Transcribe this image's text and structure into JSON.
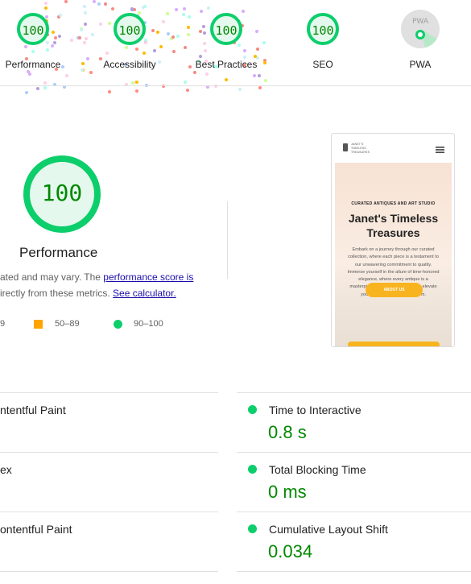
{
  "categories": [
    {
      "label": "Performance",
      "score": "100"
    },
    {
      "label": "Accessibility",
      "score": "100"
    },
    {
      "label": "Best Practices",
      "score": "100"
    },
    {
      "label": "SEO",
      "score": "100"
    }
  ],
  "pwa": {
    "label": "PWA",
    "badge_text": "PWA"
  },
  "colors": {
    "pass": "#0cce6b",
    "average": "#ffa400",
    "pass_text": "#008800"
  },
  "performance": {
    "score": "100",
    "title": "Performance",
    "line1_prefix": "ated and may vary. The ",
    "line1_link": "performance score is",
    "line2_prefix": "irectly from these metrics. ",
    "line2_link": "See calculator."
  },
  "legend": [
    {
      "range": "9"
    },
    {
      "range": "50–89"
    },
    {
      "range": "90–100"
    }
  ],
  "preview": {
    "logo_text": "JANET'S TIMELESS TREASURES",
    "eyebrow": "CURATED ANTIQUES AND ART STUDIO",
    "heading_line1": "Janet's Timeless",
    "heading_line2": "Treasures",
    "body": "Embark on a journey through our curated collection, where each piece is a testament to our unwavering commitment to quality. Immerse yourself in the allure of time-honored elegance, where every antique is a masterpiece meticulously chosen to elevate your space with enduring charm.",
    "button": "ABOUT US"
  },
  "metrics_left": [
    {
      "title": "ntentful Paint"
    },
    {
      "title": "ex"
    },
    {
      "title": "ontentful Paint"
    }
  ],
  "metrics_right": [
    {
      "title": "Time to Interactive",
      "value": "0.8 s"
    },
    {
      "title": "Total Blocking Time",
      "value": "0 ms"
    },
    {
      "title": "Cumulative Layout Shift",
      "value": "0.034"
    }
  ]
}
